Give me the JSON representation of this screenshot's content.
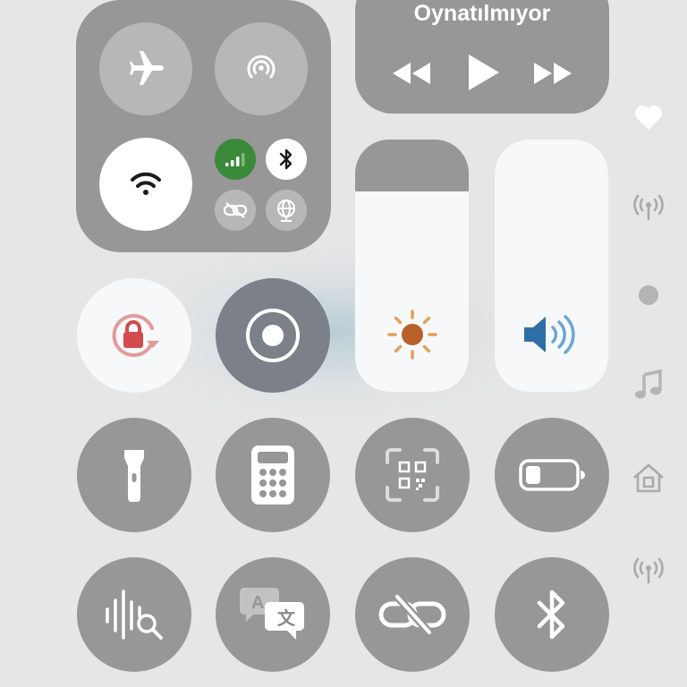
{
  "now_playing": {
    "title": "Oynatılmıyor",
    "controls": [
      "backward-icon",
      "play-icon",
      "forward-icon"
    ]
  },
  "connectivity": {
    "airplane_mode": false,
    "airdrop": false,
    "wifi": true,
    "cellular_data": true,
    "bluetooth": true,
    "personal_hotspot": false,
    "vpn": false
  },
  "tiles": [
    {
      "name": "orientation-lock",
      "icon": "lock-rotation-icon",
      "active": true
    },
    {
      "name": "screen-recording",
      "icon": "record-icon",
      "active": false
    },
    {
      "name": "flashlight",
      "icon": "flashlight-icon",
      "active": false
    },
    {
      "name": "calculator",
      "icon": "calculator-icon",
      "active": false
    },
    {
      "name": "code-scanner",
      "icon": "qr-scanner-icon",
      "active": false
    },
    {
      "name": "low-power-mode",
      "icon": "battery-icon",
      "active": false
    },
    {
      "name": "music-recognition",
      "icon": "sound-recognition-icon",
      "active": false
    },
    {
      "name": "translate",
      "icon": "translate-icon",
      "active": false
    },
    {
      "name": "hotspot",
      "icon": "link-off-icon",
      "active": false
    },
    {
      "name": "bluetooth",
      "icon": "bluetooth-icon",
      "active": false
    }
  ],
  "sliders": {
    "brightness": {
      "level": 0.82,
      "icon": "sun-icon"
    },
    "volume": {
      "level": 1.0,
      "icon": "speaker-icon"
    }
  },
  "side_rail": [
    "heart-icon",
    "antenna-icon",
    "dot-icon",
    "music-note-icon",
    "home-icon",
    "antenna-icon"
  ],
  "colors": {
    "background": "#e6e6e6",
    "tile": "#979797",
    "tile_light": "#b7b7b7",
    "active": "#f7f8f9",
    "cellular_green": "#3b8a3a",
    "lock_red": "#d24b4e",
    "sun_orange": "#b8612a",
    "speaker_blue": "#2e6fa8"
  }
}
